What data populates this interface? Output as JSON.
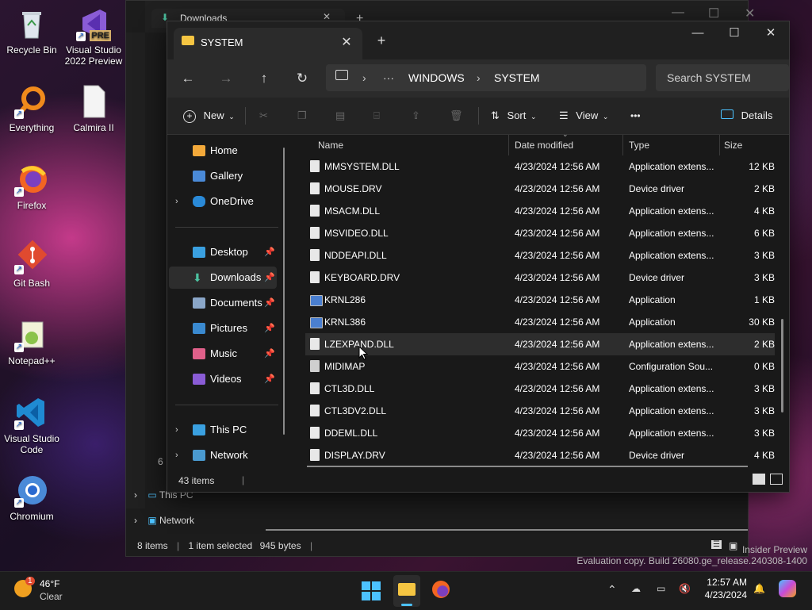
{
  "desktop": {
    "icons": [
      {
        "label": "Recycle Bin"
      },
      {
        "label": "Visual Studio 2022 Preview",
        "badge": "PRE"
      },
      {
        "label": "Everything"
      },
      {
        "label": "Calmira II"
      },
      {
        "label": "Firefox"
      },
      {
        "label": "Git Bash"
      },
      {
        "label": "Notepad++"
      },
      {
        "label": "Visual Studio Code"
      },
      {
        "label": "Chromium"
      }
    ]
  },
  "background_window": {
    "tab_title": "Downloads",
    "nav": [
      {
        "label": "This PC"
      },
      {
        "label": "Network"
      }
    ],
    "status": {
      "items": "8 items",
      "selected": "1 item selected",
      "size": "945 bytes"
    },
    "left_count": "6"
  },
  "window": {
    "tab_title": "SYSTEM",
    "breadcrumb": [
      "WINDOWS",
      "SYSTEM"
    ],
    "ellipsis": "···",
    "search_placeholder": "Search SYSTEM",
    "toolbar": {
      "new": "New",
      "sort": "Sort",
      "view": "View",
      "more": "•••",
      "details": "Details"
    },
    "sidebar": [
      {
        "label": "Home",
        "icon": "home-icon"
      },
      {
        "label": "Gallery",
        "icon": "gallery-icon"
      },
      {
        "label": "OneDrive",
        "icon": "cloud-icon"
      },
      {
        "label": "Desktop",
        "icon": "desktop-icon"
      },
      {
        "label": "Downloads",
        "icon": "download-icon"
      },
      {
        "label": "Documents",
        "icon": "documents-icon"
      },
      {
        "label": "Pictures",
        "icon": "pictures-icon"
      },
      {
        "label": "Music",
        "icon": "music-icon"
      },
      {
        "label": "Videos",
        "icon": "videos-icon"
      },
      {
        "label": "This PC",
        "icon": "pc-icon"
      },
      {
        "label": "Network",
        "icon": "network-icon"
      }
    ],
    "columns": [
      "Name",
      "Date modified",
      "Type",
      "Size"
    ],
    "files": [
      {
        "name": "MMSYSTEM.DLL",
        "date": "4/23/2024 12:56 AM",
        "type": "Application extens...",
        "size": "12 KB",
        "kind": "file"
      },
      {
        "name": "MOUSE.DRV",
        "date": "4/23/2024 12:56 AM",
        "type": "Device driver",
        "size": "2 KB",
        "kind": "file"
      },
      {
        "name": "MSACM.DLL",
        "date": "4/23/2024 12:56 AM",
        "type": "Application extens...",
        "size": "4 KB",
        "kind": "file"
      },
      {
        "name": "MSVIDEO.DLL",
        "date": "4/23/2024 12:56 AM",
        "type": "Application extens...",
        "size": "6 KB",
        "kind": "file"
      },
      {
        "name": "NDDEAPI.DLL",
        "date": "4/23/2024 12:56 AM",
        "type": "Application extens...",
        "size": "3 KB",
        "kind": "file"
      },
      {
        "name": "KEYBOARD.DRV",
        "date": "4/23/2024 12:56 AM",
        "type": "Device driver",
        "size": "3 KB",
        "kind": "file"
      },
      {
        "name": "KRNL286",
        "date": "4/23/2024 12:56 AM",
        "type": "Application",
        "size": "1 KB",
        "kind": "app"
      },
      {
        "name": "KRNL386",
        "date": "4/23/2024 12:56 AM",
        "type": "Application",
        "size": "30 KB",
        "kind": "app"
      },
      {
        "name": "LZEXPAND.DLL",
        "date": "4/23/2024 12:56 AM",
        "type": "Application extens...",
        "size": "2 KB",
        "kind": "file"
      },
      {
        "name": "MIDIMAP",
        "date": "4/23/2024 12:56 AM",
        "type": "Configuration Sou...",
        "size": "0 KB",
        "kind": "cfg"
      },
      {
        "name": "CTL3D.DLL",
        "date": "4/23/2024 12:56 AM",
        "type": "Application extens...",
        "size": "3 KB",
        "kind": "file"
      },
      {
        "name": "CTL3DV2.DLL",
        "date": "4/23/2024 12:56 AM",
        "type": "Application extens...",
        "size": "3 KB",
        "kind": "file"
      },
      {
        "name": "DDEML.DLL",
        "date": "4/23/2024 12:56 AM",
        "type": "Application extens...",
        "size": "3 KB",
        "kind": "file"
      },
      {
        "name": "DISPLAY.DRV",
        "date": "4/23/2024 12:56 AM",
        "type": "Device driver",
        "size": "4 KB",
        "kind": "file"
      }
    ],
    "hovered_file": "LZEXPAND.DLL",
    "status": {
      "count": "43 items"
    }
  },
  "watermark": {
    "line1": "Insider Preview",
    "line2": "Evaluation copy. Build 26080.ge_release.240308-1400"
  },
  "taskbar": {
    "weather": {
      "temp": "46°F",
      "condition": "Clear",
      "badge": "1"
    },
    "time": "12:57 AM",
    "date": "4/23/2024"
  },
  "colors": {
    "accent": "#4cc2ff",
    "folder": "#f5c542",
    "window_bg": "#191919"
  }
}
